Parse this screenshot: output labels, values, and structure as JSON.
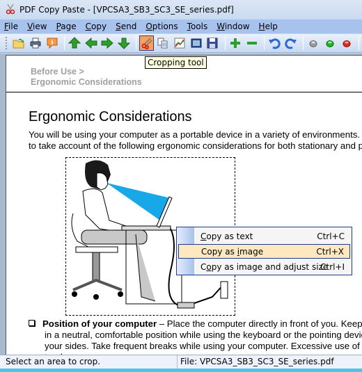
{
  "window": {
    "title": "PDF Copy Paste - [VPCSA3_SB3_SC3_SE_series.pdf]",
    "app_icon": "scissors-icon"
  },
  "menubar": [
    {
      "label": "File",
      "accel": "F"
    },
    {
      "label": "View",
      "accel": "V"
    },
    {
      "label": "Page",
      "accel": "P"
    },
    {
      "label": "Copy",
      "accel": "C"
    },
    {
      "label": "Send",
      "accel": "S"
    },
    {
      "label": "Options",
      "accel": "O"
    },
    {
      "label": "Tools",
      "accel": "T"
    },
    {
      "label": "Window",
      "accel": "W"
    },
    {
      "label": "Help",
      "accel": "H"
    }
  ],
  "toolbar": {
    "buttons": [
      "open-icon",
      "print-icon",
      "info-icon",
      "first-page-icon",
      "previous-page-icon",
      "next-page-icon",
      "last-page-icon",
      "cropping-tool-icon",
      "copy-pages-icon",
      "chart-icon",
      "select-area-icon",
      "save-icon",
      "zoom-in-icon",
      "zoom-out-icon",
      "undo-icon",
      "redo-icon",
      "gray-light-icon",
      "green-light-icon",
      "red-light-icon"
    ],
    "active": "cropping-tool-icon",
    "tooltip": "Cropping tool"
  },
  "document": {
    "breadcrumb_line1": "Before Use >",
    "breadcrumb_line2": "Ergonomic Considerations",
    "heading": "Ergonomic Considerations",
    "paragraph": [
      "You will be using your computer as a portable device in a variety of environments. W",
      "to take account of the following ergonomic considerations for both stationary and po"
    ],
    "bullet": {
      "bold": "Position of your computer",
      "line1_rest": " – Place the computer directly in front of you. Keep yo",
      "line2": "in a neutral, comfortable position while using the keyboard or the pointing device",
      "line3": "your sides. Take frequent breaks while using your computer. Excessive use of the",
      "line4": "tendons"
    }
  },
  "context_menu": {
    "items": [
      {
        "pre": "",
        "accel": "C",
        "post": "opy as text",
        "shortcut": "Ctrl+C",
        "highlighted": false
      },
      {
        "pre": "Copy as ",
        "accel": "i",
        "post": "mage",
        "shortcut": "Ctrl+X",
        "highlighted": true
      },
      {
        "pre": "C",
        "accel": "o",
        "post": "py as image and adjust size",
        "shortcut": "Ctrl+I",
        "highlighted": false
      }
    ]
  },
  "statusbar": {
    "message": "Select an area to crop.",
    "file": "File: VPCSA3_SB3_SC3_SE_series.pdf"
  }
}
